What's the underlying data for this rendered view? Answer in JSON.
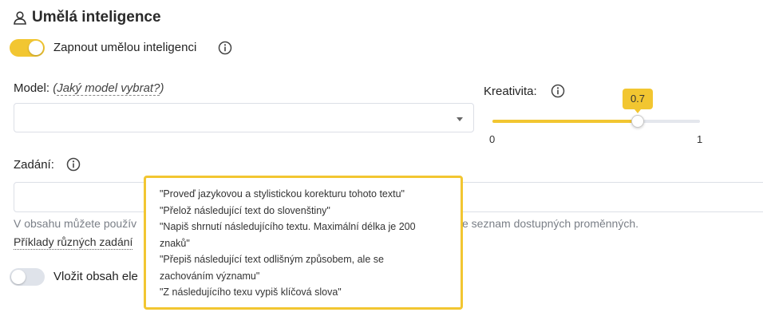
{
  "section": {
    "title": "Umělá inteligence",
    "icon": "user-icon"
  },
  "ai_toggle": {
    "label": "Zapnout umělou inteligenci",
    "on": true,
    "info_icon": "info-icon"
  },
  "model": {
    "label": "Model:",
    "hint_open": "(",
    "hint_link": "Jaký model vybrat?",
    "hint_close": ")",
    "selected_value": ""
  },
  "creativity": {
    "label": "Kreativita:",
    "value": 0.7,
    "value_label": "0.7",
    "min": 0,
    "max": 1,
    "min_label": "0",
    "max_label": "1"
  },
  "prompt": {
    "label": "Zadání:",
    "value": ""
  },
  "help": {
    "left": "V obsahu můžete použív",
    "right": "e seznam dostupných proměnných."
  },
  "examples_link": "Příklady různých zadání",
  "insert_toggle": {
    "label": "Vložit obsah ele",
    "on": false
  },
  "examples_popover": [
    "\"Proveď jazykovou a stylistickou korekturu tohoto textu\"",
    "\"Přelož následující text do slovenštiny\"",
    "\"Napiš shrnutí následujícího textu. Maximální délka je 200",
    "znaků\"",
    "\"Přepiš následující text odlišným způsobem, ale se",
    "zachováním významu\"",
    "\"Z následujícího texu vypiš klíčová slova\""
  ],
  "colors": {
    "accent": "#f2c631",
    "border": "#dcdfe6",
    "muted_text": "#7a7f87"
  }
}
